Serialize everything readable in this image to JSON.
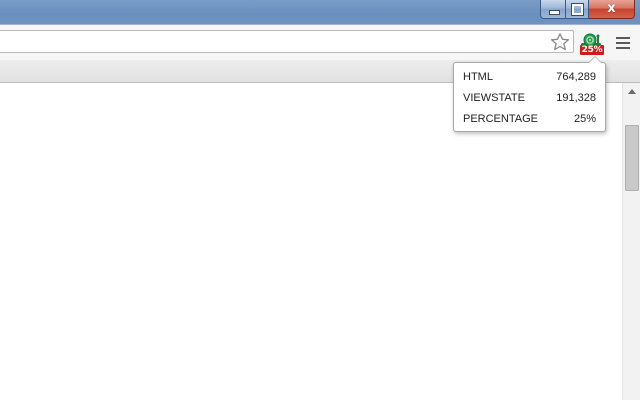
{
  "window": {
    "close_glyph": "x"
  },
  "toolbar": {
    "extension_badge": "25%",
    "icons": {
      "bookmark": "star-icon",
      "extension": "snail-icon",
      "menu": "hamburger-icon"
    }
  },
  "popup": {
    "rows": [
      {
        "label": "HTML",
        "value": "764,289"
      },
      {
        "label": "VIEWSTATE",
        "value": "191,328"
      },
      {
        "label": "PERCENTAGE",
        "value": "25%"
      }
    ]
  },
  "colors": {
    "titlebar": "#6e93c3",
    "badge": "#d11b1b",
    "close_button": "#c7432c",
    "snail": "#1a9a4a"
  }
}
